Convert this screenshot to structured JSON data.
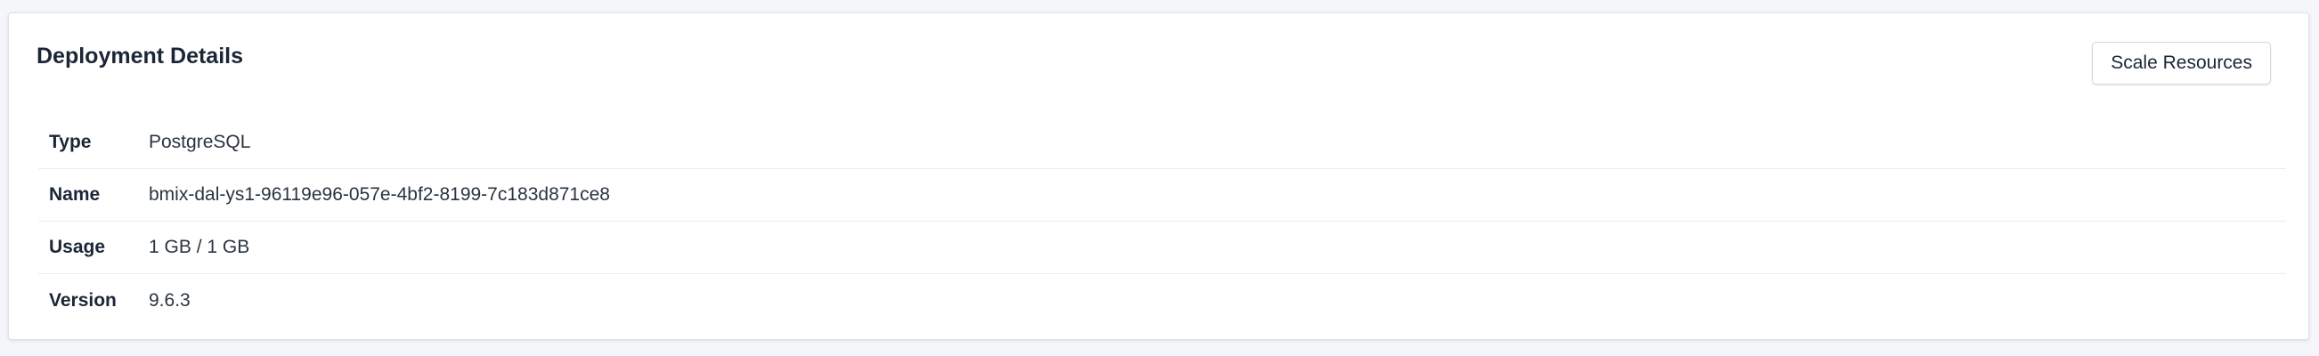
{
  "card": {
    "title": "Deployment Details",
    "scale_button_label": "Scale Resources"
  },
  "details": [
    {
      "label": "Type",
      "value": "PostgreSQL"
    },
    {
      "label": "Name",
      "value": "bmix-dal-ys1-96119e96-057e-4bf2-8199-7c183d871ce8"
    },
    {
      "label": "Usage",
      "value": "1 GB / 1 GB"
    },
    {
      "label": "Version",
      "value": "9.6.3"
    }
  ]
}
